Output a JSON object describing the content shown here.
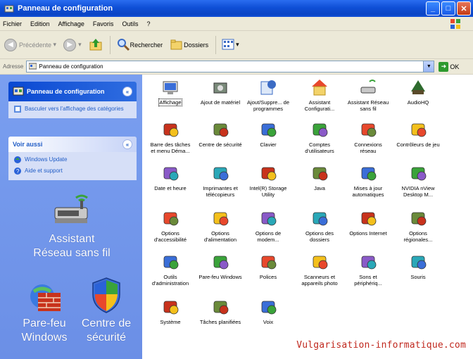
{
  "window": {
    "title": "Panneau de configuration"
  },
  "menu": [
    "Fichier",
    "Edition",
    "Affichage",
    "Favoris",
    "Outils",
    "?"
  ],
  "toolbar": {
    "back": "Précédente",
    "search": "Rechercher",
    "folders": "Dossiers"
  },
  "address": {
    "label": "Adresse",
    "value": "Panneau de configuration",
    "go": "OK"
  },
  "sidebar": {
    "panel1": {
      "title": "Panneau de configuration",
      "link": "Basculer vers l'affichage des catégories"
    },
    "panel2": {
      "title": "Voir aussi",
      "links": [
        "Windows Update",
        "Aide et support"
      ]
    },
    "big_items": {
      "wireless": "Assistant Réseau sans fil",
      "firewall": "Pare-feu Windows",
      "security": "Centre de sécurité"
    }
  },
  "items": [
    "Affichage",
    "Ajout de matériel",
    "Ajout/Suppre... de programmes",
    "Assistant Configurati...",
    "Assistant Réseau sans fil",
    "AudioHQ",
    "Barre des tâches et menu Déma...",
    "Centre de sécurité",
    "Clavier",
    "Comptes d'utilisateurs",
    "Connexions réseau",
    "Contrôleurs de jeu",
    "Date et heure",
    "Imprimantes et télécopieurs",
    "Intel(R) Storage Utility",
    "Java",
    "Mises à jour automatiques",
    "NVIDIA nView Desktop M...",
    "Options d'accessibilité",
    "Options d'alimentation",
    "Options de modem...",
    "Options des dossiers",
    "Options Internet",
    "Options régionales...",
    "Outils d'administration",
    "Pare-feu Windows",
    "Polices",
    "Scanneurs et appareils photo",
    "Sons et périphériq...",
    "Souris",
    "Système",
    "Tâches planifiées",
    "Voix"
  ],
  "watermark": "Vulgarisation-informatique.com",
  "colors": {
    "titlebar": "#0f4fd6",
    "sidebar": "#6b8fe6",
    "link": "#215dc6",
    "watermark": "#c0281e"
  }
}
